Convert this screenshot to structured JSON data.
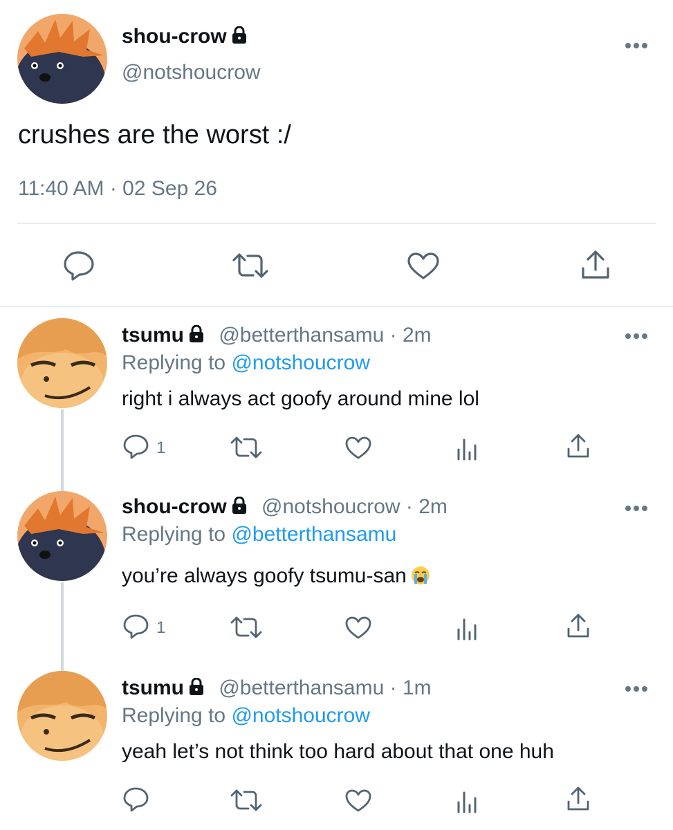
{
  "main_tweet": {
    "author_name": "shou-crow",
    "handle": "@notshoucrow",
    "text": "crushes are the worst :/",
    "timestamp": "11:40 AM · 02 Sep 26"
  },
  "replies": [
    {
      "author_name": "tsumu",
      "handle": "@betterthansamu",
      "time_sep": " · ",
      "time": "2m",
      "replying_prefix": "Replying to ",
      "replying_to": "@notshoucrow",
      "text": "right i always act goofy around mine lol",
      "reply_count": "1"
    },
    {
      "author_name": "shou-crow",
      "handle": "@notshoucrow",
      "time_sep": " · ",
      "time": "2m",
      "replying_prefix": "Replying to ",
      "replying_to": "@betterthansamu",
      "text": "you’re always goofy tsumu-san",
      "reply_count": "1"
    },
    {
      "author_name": "tsumu",
      "handle": "@betterthansamu",
      "time_sep": " · ",
      "time": "1m",
      "replying_prefix": "Replying to ",
      "replying_to": "@notshoucrow",
      "text": "yeah let’s not think too hard about that one huh",
      "reply_count": ""
    }
  ],
  "colors": {
    "accent": "#1d9bf0",
    "secondary_text": "#657786",
    "divider": "#e6ecf0"
  },
  "icons": [
    "lock-icon",
    "more-icon",
    "reply-icon",
    "retweet-icon",
    "like-icon",
    "analytics-icon",
    "share-icon",
    "crying-emoji"
  ]
}
